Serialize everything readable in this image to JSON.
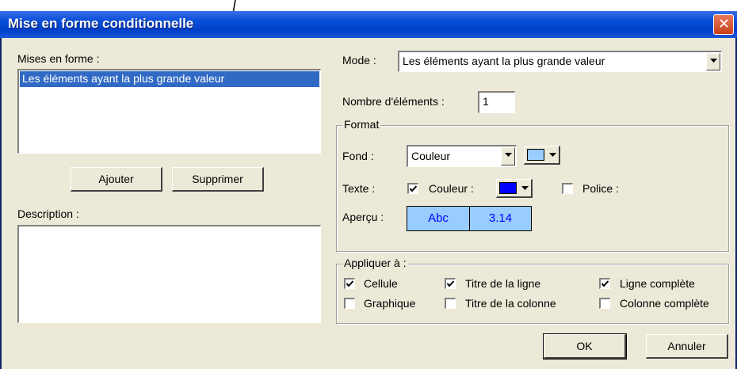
{
  "window": {
    "title": "Mise en forme conditionnelle",
    "titlebar_color": "#0040c8",
    "close_icon": "close-icon"
  },
  "left": {
    "formats_label": "Mises en forme :",
    "formats_items": [
      "Les éléments ayant la plus grande valeur"
    ],
    "selected_index": 0,
    "add_button": "Ajouter",
    "remove_button": "Supprimer",
    "description_label": "Description :",
    "description_value": ""
  },
  "mode": {
    "label": "Mode :",
    "value": "Les éléments ayant la plus grande valeur"
  },
  "count": {
    "label": "Nombre d'éléments :",
    "value": "1"
  },
  "format": {
    "group_title": "Format",
    "background_label": "Fond :",
    "background_value": "Couleur",
    "background_color": "#99ccff",
    "text_label": "Texte :",
    "text_color_checkbox": "Couleur :",
    "text_color_checked": true,
    "text_color": "#0000ff",
    "font_checkbox": "Police :",
    "font_checked": false,
    "preview_label": "Aperçu :",
    "preview_text": "Abc",
    "preview_number": "3.14"
  },
  "apply": {
    "group_title": "Appliquer à :",
    "options": [
      {
        "label": "Cellule",
        "checked": true
      },
      {
        "label": "Titre de la ligne",
        "checked": true
      },
      {
        "label": "Ligne complète",
        "checked": true
      },
      {
        "label": "Graphique",
        "checked": false
      },
      {
        "label": "Titre de la colonne",
        "checked": false
      },
      {
        "label": "Colonne complète",
        "checked": false
      }
    ]
  },
  "buttons": {
    "ok": "OK",
    "cancel": "Annuler"
  }
}
